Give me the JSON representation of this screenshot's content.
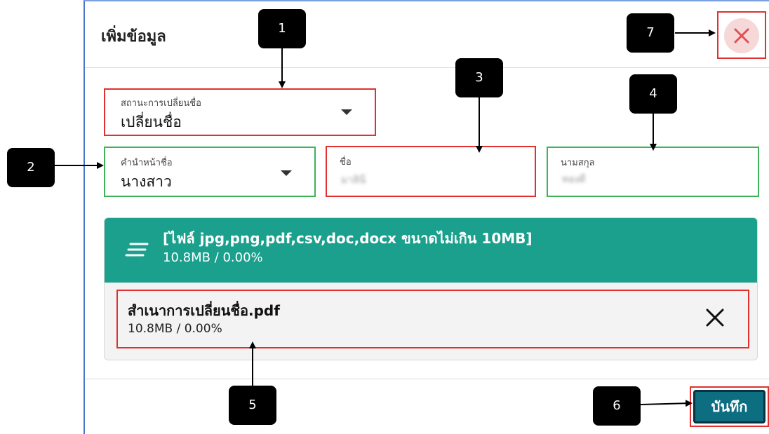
{
  "dialog": {
    "title": "เพิ่มข้อมูล",
    "close_icon": "close-icon"
  },
  "fields": {
    "status": {
      "label": "สถานะการเปลี่ยนชื่อ",
      "value": "เปลี่ยนชื่อ"
    },
    "prefix": {
      "label": "คำนำหน้าชื่อ",
      "value": "นางสาว"
    },
    "first_name": {
      "label": "ชื่อ",
      "value": "มาลินี"
    },
    "last_name": {
      "label": "นามสกุล",
      "value": "ทองดี"
    }
  },
  "upload": {
    "title": "[ไฟล์ jpg,png,pdf,csv,doc,docx ขนาดไม่เกิน 10MB]",
    "size": "10.8MB / 0.00%",
    "files": [
      {
        "name": "สำเนาการเปลี่ยนชื่อ.pdf",
        "size": "10.8MB / 0.00%"
      }
    ]
  },
  "actions": {
    "save_label": "บันทึก"
  },
  "callouts": [
    "1",
    "2",
    "3",
    "4",
    "5",
    "6",
    "7"
  ],
  "colors": {
    "accent": "#1aa08c",
    "save_button": "#0c6e80",
    "highlight_red": "#e03030",
    "highlight_green": "#3fb35a"
  }
}
